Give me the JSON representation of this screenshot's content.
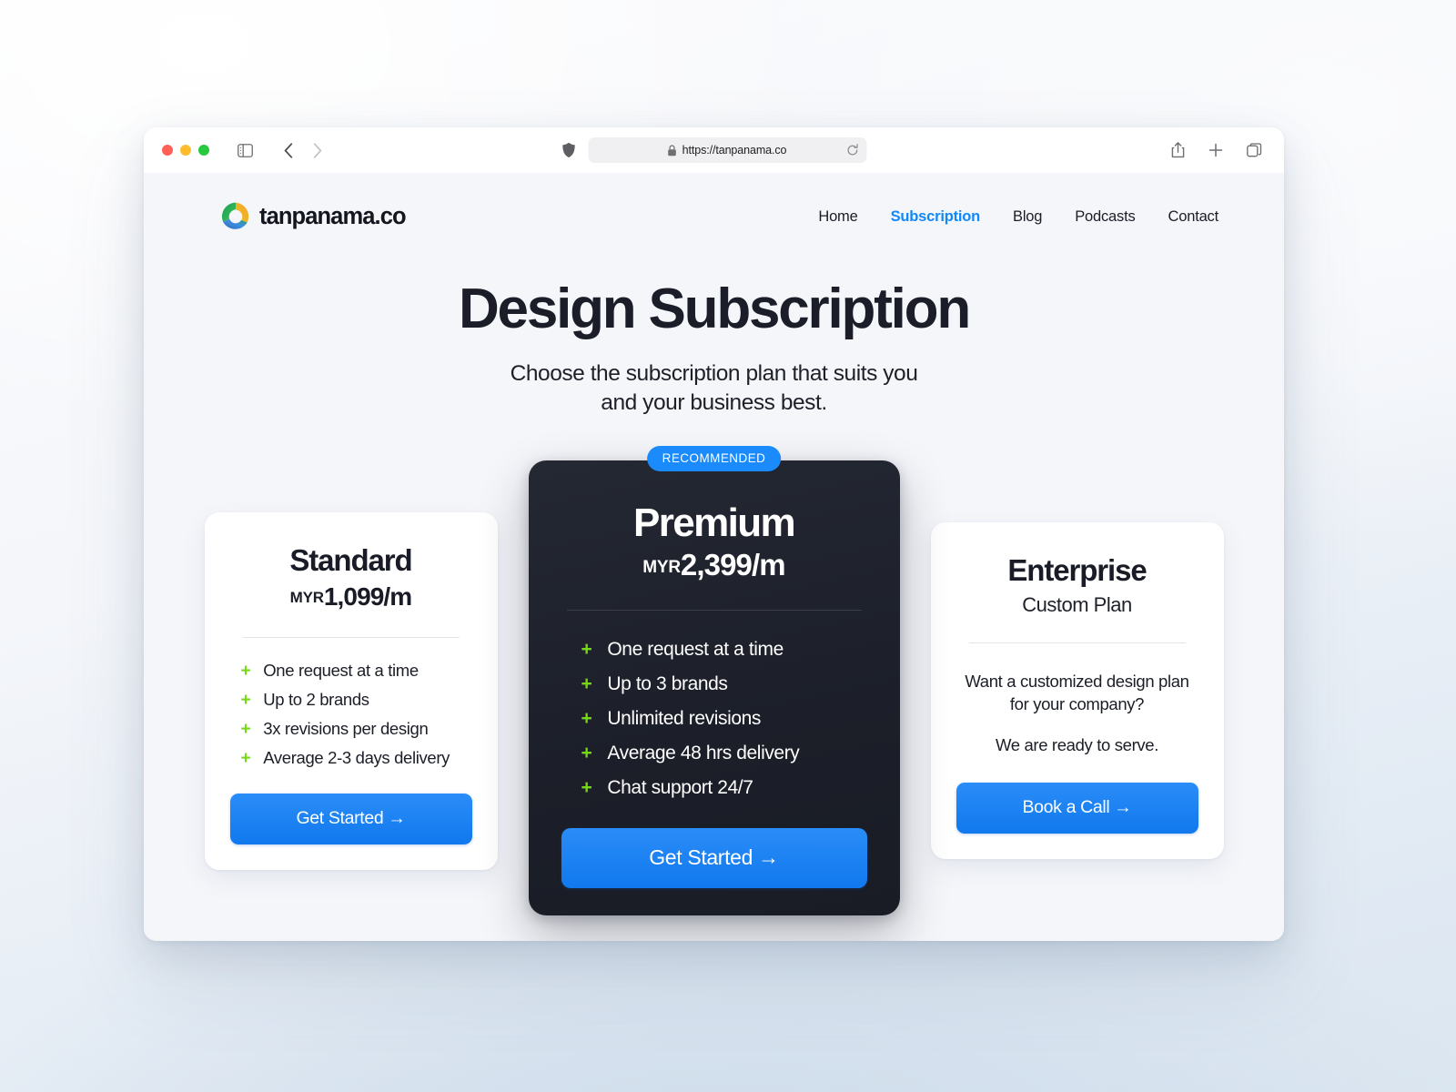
{
  "browser": {
    "url": "https://tanpanama.co",
    "traffic_lights": [
      "close",
      "minimize",
      "maximize"
    ],
    "icons": {
      "sidebar": "sidebar-toggle-icon",
      "back": "back-chevron-icon",
      "forward": "forward-chevron-icon",
      "shield": "privacy-shield-icon",
      "lock": "lock-icon",
      "reload": "reload-icon",
      "share": "share-icon",
      "new_tab": "plus-icon",
      "tab_overview": "tab-overview-icon"
    }
  },
  "site": {
    "brand": "tanpanama.co",
    "nav": [
      {
        "label": "Home",
        "active": false
      },
      {
        "label": "Subscription",
        "active": true
      },
      {
        "label": "Blog",
        "active": false
      },
      {
        "label": "Podcasts",
        "active": false
      },
      {
        "label": "Contact",
        "active": false
      }
    ]
  },
  "hero": {
    "title": "Design Subscription",
    "subtitle_line1": "Choose the subscription plan that suits you",
    "subtitle_line2": "and your business best."
  },
  "plans": {
    "standard": {
      "name": "Standard",
      "currency": "MYR",
      "price": "1,099/m",
      "features": [
        "One request at a time",
        "Up to 2 brands",
        "3x revisions per design",
        "Average 2-3 days delivery"
      ],
      "cta": "Get Started →"
    },
    "premium": {
      "badge": "RECOMMENDED",
      "name": "Premium",
      "currency": "MYR",
      "price": "2,399/m",
      "features": [
        "One request at a time",
        "Up to 3 brands",
        "Unlimited revisions",
        "Average 48 hrs delivery",
        "Chat support 24/7"
      ],
      "cta": "Get Started →"
    },
    "enterprise": {
      "name": "Enterprise",
      "subtitle": "Custom Plan",
      "copy_line1": "Want a customized design plan for your company?",
      "copy_line2": "We are ready to serve.",
      "cta": "Book a Call →"
    }
  },
  "colors": {
    "accent_blue": "#1288f7",
    "cta_blue": "#1179ee",
    "badge_blue": "#1b8afb",
    "feature_green": "#76d914",
    "dark_card": "#1c1f29",
    "text_dark": "#1b1e29",
    "page_bg": "#f5f6fa"
  }
}
